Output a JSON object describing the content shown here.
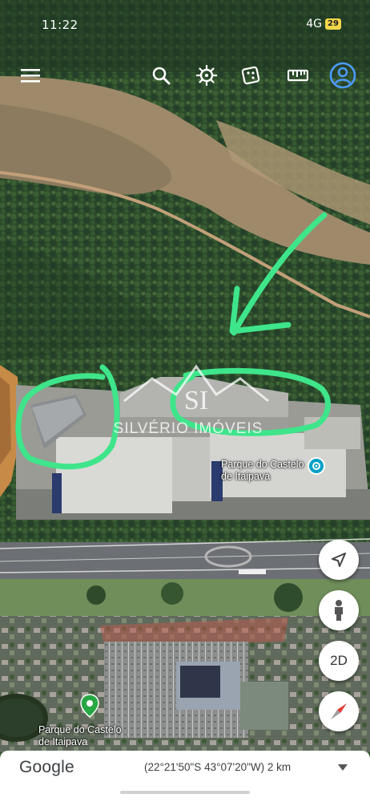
{
  "status_bar": {
    "time": "11:22",
    "network": "4G",
    "battery": "29"
  },
  "toolbar": {
    "icons": [
      "menu-icon",
      "search-icon",
      "voyager-wheel-icon",
      "dice-icon",
      "ruler-icon",
      "account-icon"
    ]
  },
  "map": {
    "type": "satellite",
    "poi_label_upper": "Parque do Castelo\nde Itaipava",
    "poi_label_lower": "Parque do Castelo\nde Itaipava",
    "watermark_text": "SILVÉRIO IMÓVEIS",
    "watermark_monogram": "SI",
    "annotation_color": "#3ee58a"
  },
  "side_controls": {
    "twod_label": "2D",
    "icons": [
      "navigation-arrow-icon",
      "pegman-icon",
      "compass-icon"
    ]
  },
  "bottom_bar": {
    "logo": "Google",
    "coordinates": "(22°21'50\"S 43°07'20\"W) 2 km"
  },
  "colors": {
    "accent_blue": "#4d9bff",
    "annotation_green": "#3ee58a",
    "compass_red": "#e53935"
  }
}
